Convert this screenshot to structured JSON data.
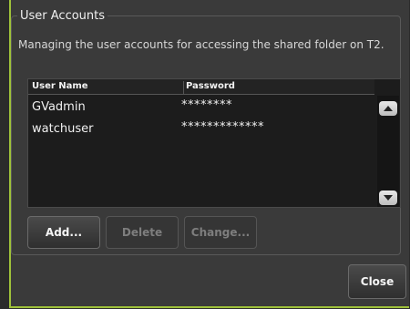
{
  "group": {
    "title": "User Accounts"
  },
  "description": "Managing the user accounts for accessing the shared folder on T2.",
  "table": {
    "headers": [
      "User Name",
      "Password"
    ],
    "rows": [
      {
        "user": "GVadmin",
        "password": "********"
      },
      {
        "user": "watchuser",
        "password": "*************"
      }
    ]
  },
  "buttons": {
    "add": "Add...",
    "delete": "Delete",
    "change": "Change...",
    "close": "Close"
  },
  "colors": {
    "accent": "#9fc23a"
  },
  "icons": {
    "scroll_up": "triangle-up",
    "scroll_down": "triangle-down"
  }
}
